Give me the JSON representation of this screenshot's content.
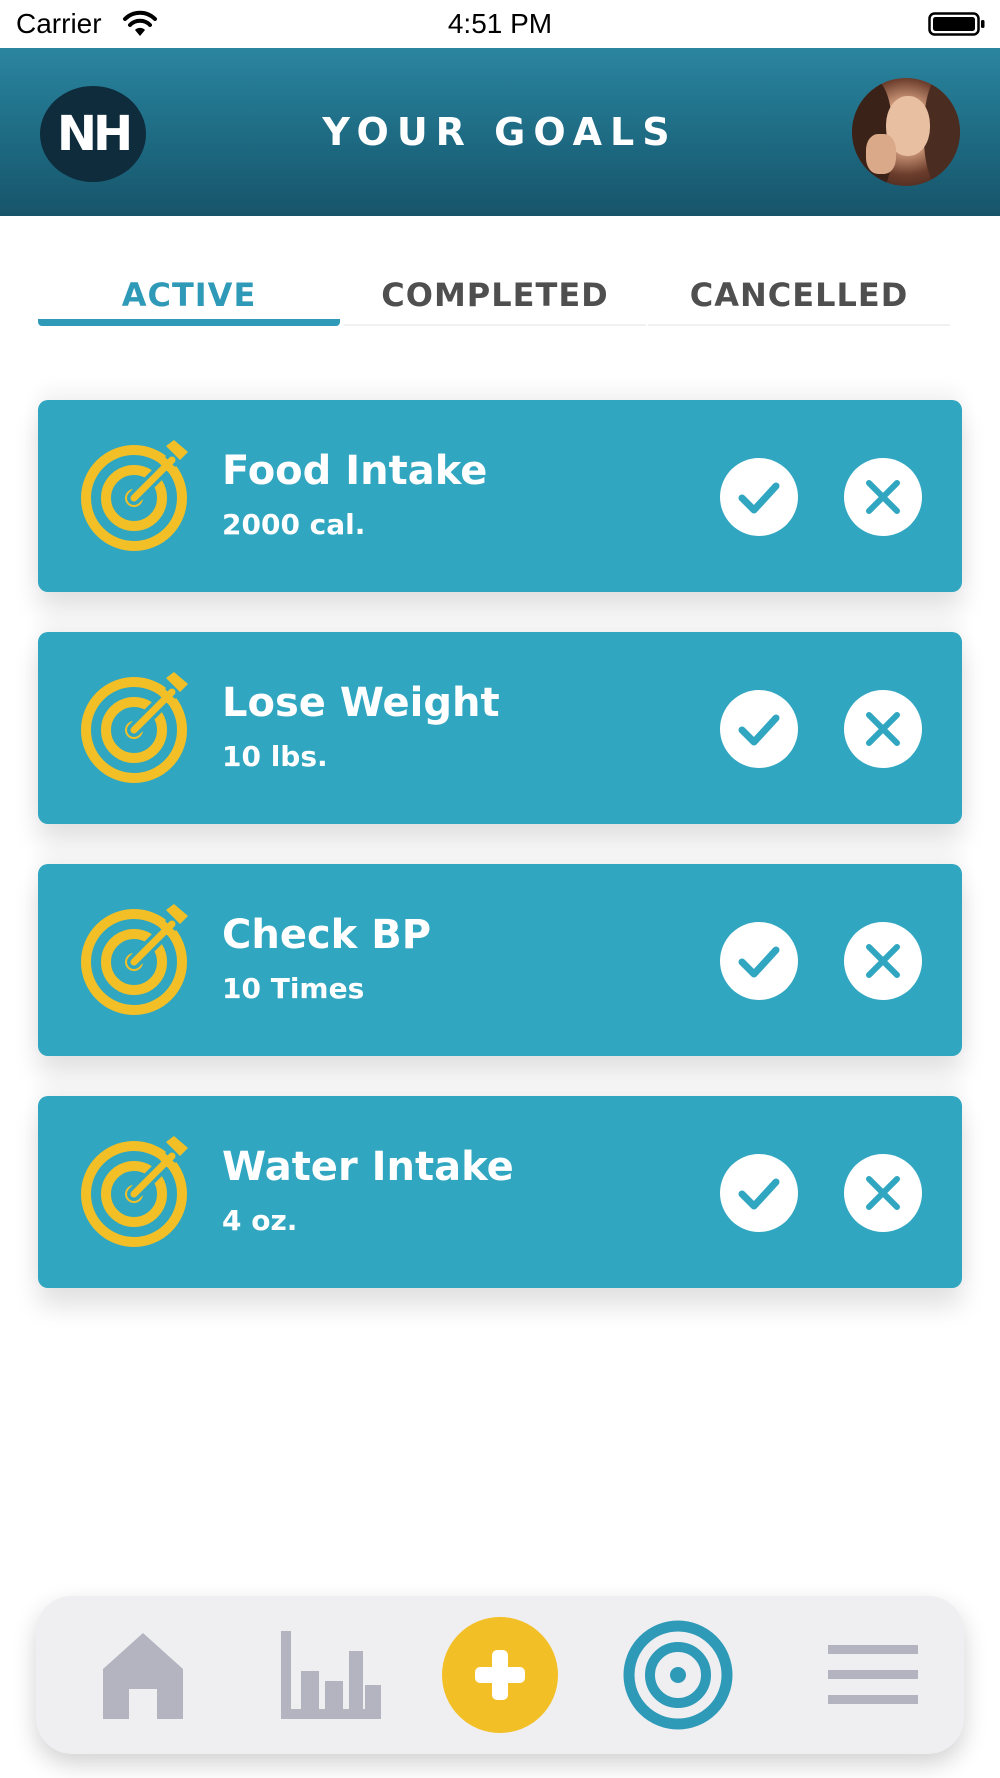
{
  "status_bar": {
    "carrier": "Carrier",
    "time": "4:51 PM"
  },
  "header": {
    "logo_text": "NH",
    "title": "YOUR GOALS",
    "avatar": "profile-photo"
  },
  "tabs": [
    {
      "label": "ACTIVE",
      "selected": true
    },
    {
      "label": "COMPLETED",
      "selected": false
    },
    {
      "label": "CANCELLED",
      "selected": false
    }
  ],
  "goals": [
    {
      "name": "Food Intake",
      "target": "2000 cal."
    },
    {
      "name": "Lose Weight",
      "target": "10 lbs."
    },
    {
      "name": "Check BP",
      "target": "10 Times"
    },
    {
      "name": "Water Intake",
      "target": "4 oz."
    }
  ],
  "bottom_nav": {
    "items": [
      "home-icon",
      "stats-icon",
      "add-icon",
      "goals-icon",
      "menu-icon"
    ],
    "active": "goals-icon"
  },
  "colors": {
    "header_top": "#2b859f",
    "header_bottom": "#17546a",
    "accent": "#2e9ab8",
    "card": "#30a6c0",
    "goal_icon": "#f2bf26",
    "add_button": "#f2bf26",
    "nav_inactive": "#b4b4c0"
  }
}
